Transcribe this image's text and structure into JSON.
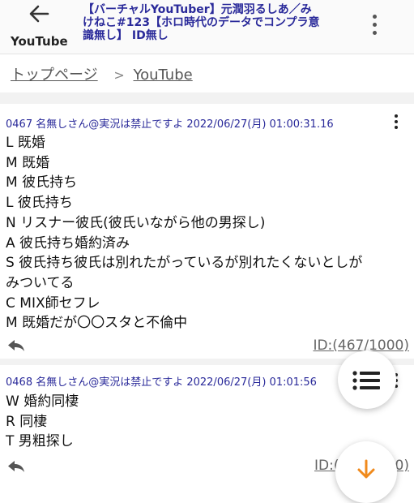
{
  "header": {
    "back_label": "YouTube",
    "title_line1": "【バーチャルYouTuber】元潤羽るしあ／み",
    "title_line2": "けねこ#123【ホロ時代のデータでコンプラ意",
    "title_line3": "識無し】 ID無し"
  },
  "breadcrumb": {
    "home": "トップページ",
    "separator": ">",
    "current": "YouTube"
  },
  "posts": [
    {
      "header": "0467 名無しさん@実況は禁止ですよ 2022/06/27(月) 01:00:31.16",
      "lines": [
        "L 既婚",
        "M 既婚",
        "M 彼氏持ち",
        "L 彼氏持ち",
        "N リスナー彼氏(彼氏いながら他の男探し)",
        "A 彼氏持ち婚約済み",
        "S 彼氏持ち彼氏は別れたがっているが別れたくないとしが",
        "みついてる",
        "C MIX師セフレ",
        "M 既婚だが〇〇スタと不倫中"
      ],
      "id_link": "ID:(467/1000)"
    },
    {
      "header": "0468 名無しさん@実況は禁止ですよ 2022/06/27(月) 01:01:56",
      "lines": [
        "W 婚約同棲",
        "R 同棲",
        "T 男粗探し"
      ],
      "id_link": "ID:(",
      "id_link_tail": "0)"
    }
  ],
  "colors": {
    "post_header": "#2a2a9a",
    "fab_arrow": "#f08a1c"
  },
  "icons": [
    "back-arrow-icon",
    "more-vert-icon",
    "reply-icon",
    "list-icon",
    "arrow-down-icon"
  ]
}
